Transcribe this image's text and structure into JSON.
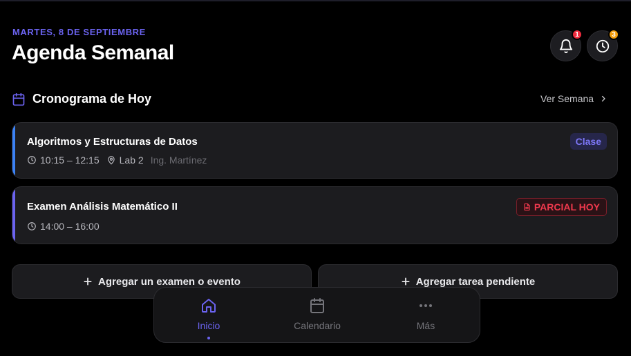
{
  "header": {
    "date": "MARTES, 8 DE SEPTIEMBRE",
    "title": "Agenda Semanal",
    "notifications_badge": "1",
    "history_badge": "3"
  },
  "section": {
    "title": "Cronograma de Hoy",
    "see_week": "Ver Semana"
  },
  "events": [
    {
      "title": "Algoritmos y Estructuras de Datos",
      "time": "10:15 – 12:15",
      "location": "Lab 2",
      "teacher": "Ing. Martínez",
      "tag": "Clase",
      "accent": "#3b82f6"
    },
    {
      "title": "Examen Análisis Matemático II",
      "time": "14:00 – 16:00",
      "tag": "PARCIAL HOY",
      "accent": "#6b63f0"
    }
  ],
  "actions": {
    "add_exam": "Agregar un examen o evento",
    "add_task": "Agregar tarea pendiente"
  },
  "nav": {
    "home": "Inicio",
    "calendar": "Calendario",
    "more": "Más"
  },
  "colors": {
    "accent": "#6b63f0",
    "danger": "#f0394d",
    "warning": "#f59e0b",
    "background": "#000000"
  }
}
